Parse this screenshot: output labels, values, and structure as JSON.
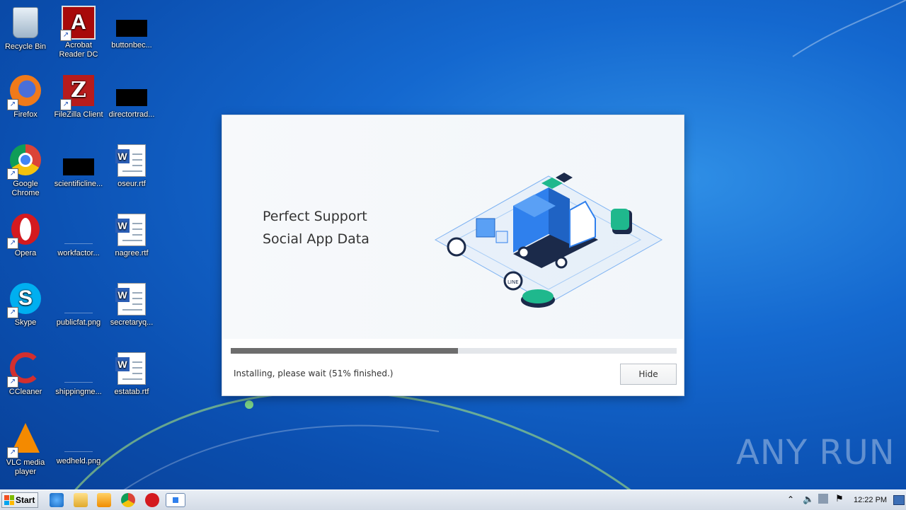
{
  "desktop": {
    "icons": [
      {
        "label": "Recycle Bin"
      },
      {
        "label": "Acrobat Reader DC"
      },
      {
        "label": "buttonbec..."
      },
      {
        "label": "Firefox"
      },
      {
        "label": "FileZilla Client"
      },
      {
        "label": "directortrad..."
      },
      {
        "label": "Google Chrome"
      },
      {
        "label": "scientificline..."
      },
      {
        "label": "oseur.rtf"
      },
      {
        "label": "Opera"
      },
      {
        "label": "workfactor..."
      },
      {
        "label": "nagree.rtf"
      },
      {
        "label": "Skype"
      },
      {
        "label": "publicfat.png"
      },
      {
        "label": "secretaryq..."
      },
      {
        "label": "CCleaner"
      },
      {
        "label": "shippingme..."
      },
      {
        "label": "estatab.rtf"
      },
      {
        "label": "VLC media player"
      },
      {
        "label": "wedheld.png"
      }
    ]
  },
  "installer": {
    "headline_line1": "Perfect Support",
    "headline_line2": "Social App Data",
    "progress_percent": 51,
    "status_text": "Installing, please wait (51% finished.)",
    "hide_label": "Hide"
  },
  "watermark": "ANY RUN",
  "taskbar": {
    "start_label": "Start",
    "clock": "12:22 PM",
    "pinned": [
      "internet-explorer",
      "file-explorer",
      "media-player",
      "chrome",
      "opera",
      "installer"
    ]
  },
  "colors": {
    "accent_blue": "#2f80ed",
    "teal": "#1fb88d",
    "progress_fill": "#6d6d6d"
  }
}
